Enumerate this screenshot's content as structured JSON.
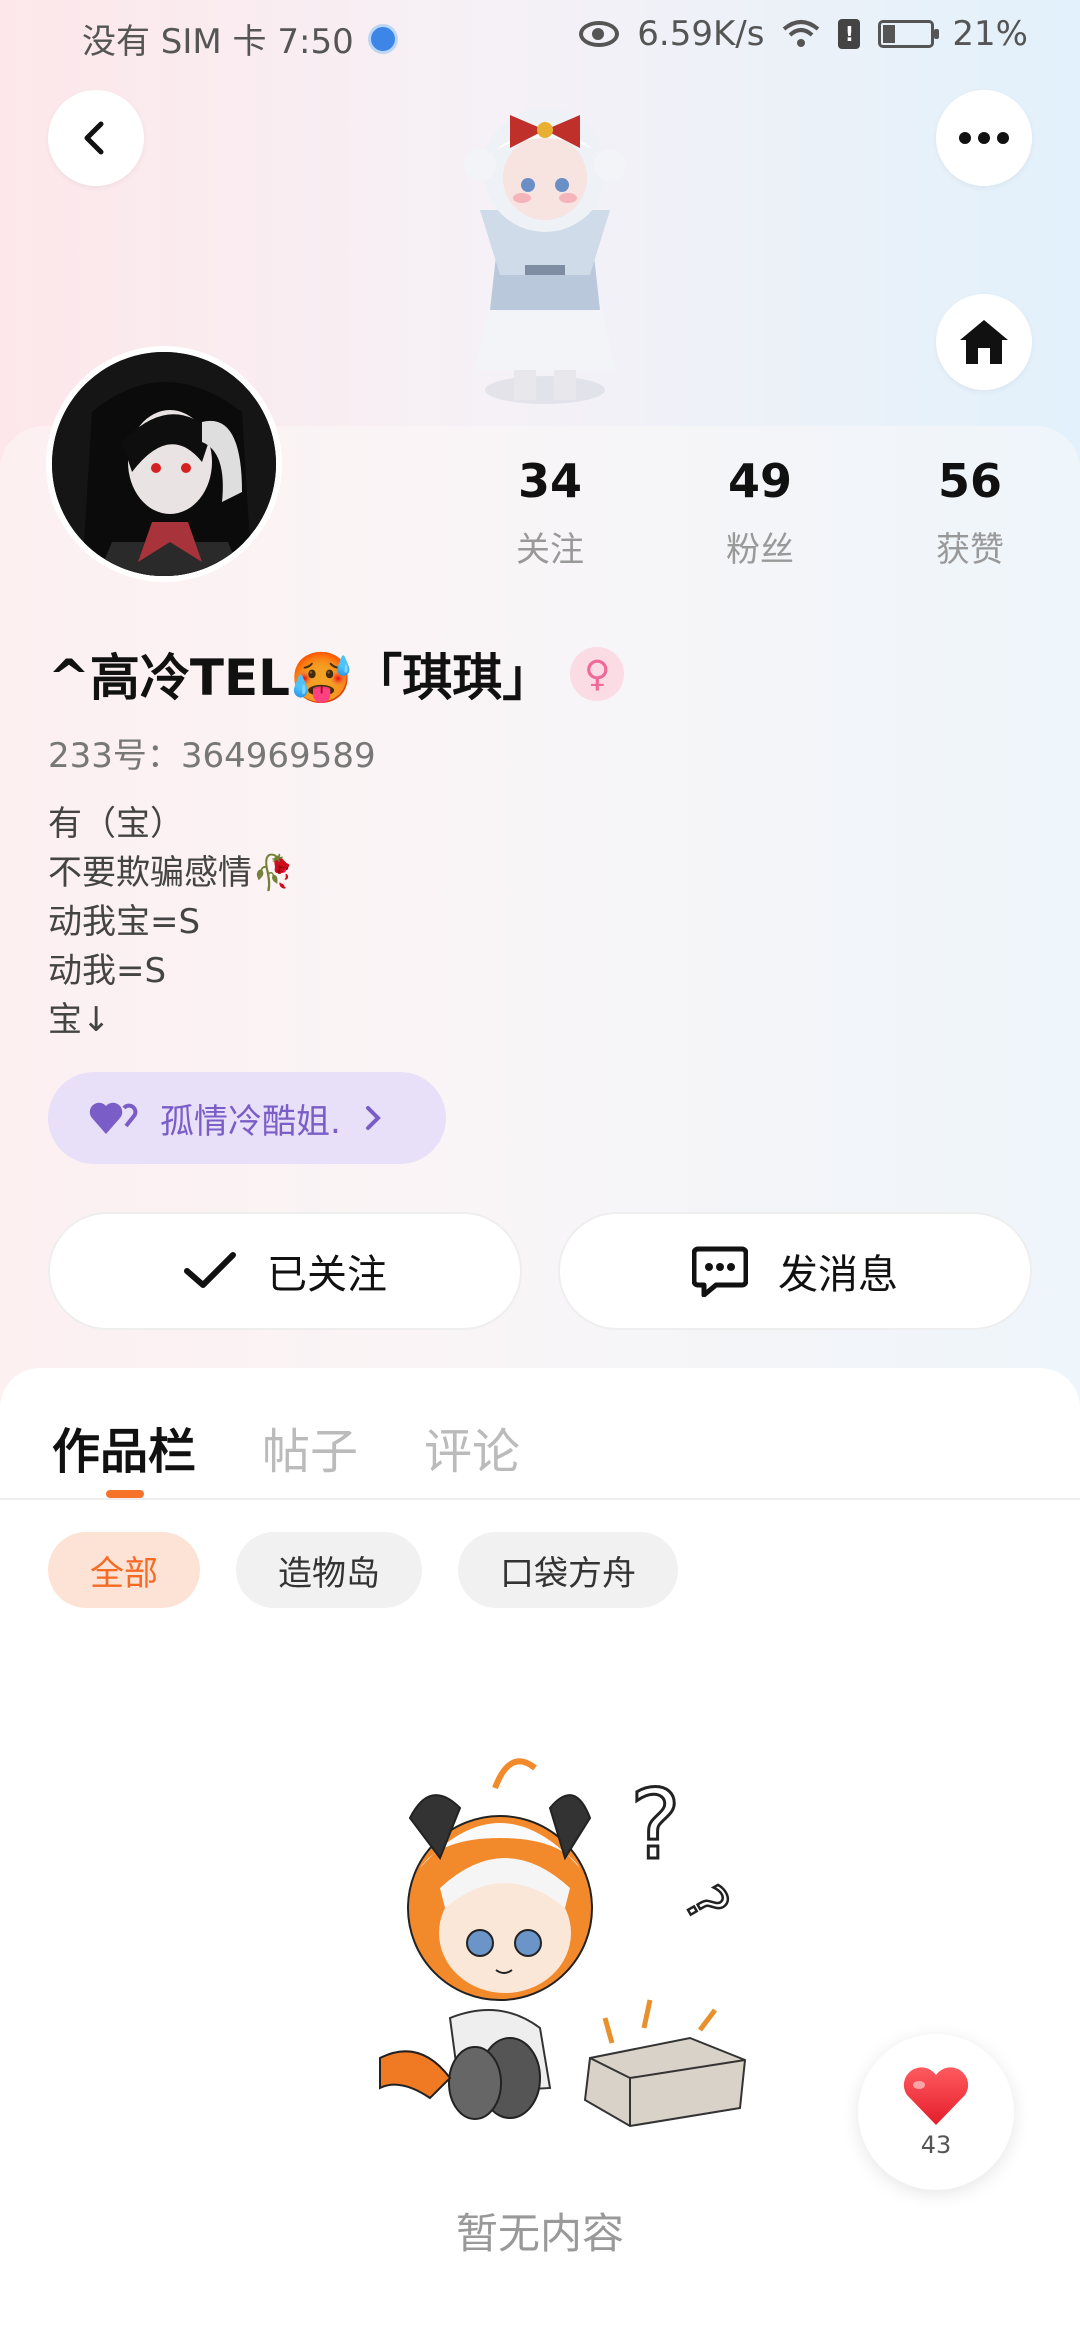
{
  "status_bar": {
    "left_text": "没有 SIM 卡 7:50",
    "speed": "6.59K/s",
    "battery": "21%"
  },
  "header": {
    "back_icon": "chevron-left-icon",
    "more_icon": "more-dots-icon",
    "home_icon": "home-icon"
  },
  "profile": {
    "stats": [
      {
        "value": "34",
        "label": "关注"
      },
      {
        "value": "49",
        "label": "粉丝"
      },
      {
        "value": "56",
        "label": "获赞"
      }
    ],
    "name": "^高冷TEL🥵「琪琪」",
    "gender_icon": "female-icon",
    "uid": "233号：364969589",
    "bio_lines": [
      "有（宝）",
      "不要欺骗感情🥀",
      "动我宝=S",
      "动我=S",
      "宝↓"
    ],
    "tag_label": "孤情冷酷姐.",
    "tag_icon": "purple-heart-icon",
    "follow_button": "已关注",
    "message_button": "发消息"
  },
  "content": {
    "tabs": [
      "作品栏",
      "帖子",
      "评论"
    ],
    "active_tab": "作品栏",
    "chips": [
      "全部",
      "造物岛",
      "口袋方舟"
    ],
    "active_chip": "全部",
    "empty_text": "暂无内容"
  },
  "like_fab": {
    "icon": "heart-icon",
    "count": "43"
  },
  "colors": {
    "accent_orange": "#f7732a",
    "tag_purple": "#7a5dc7",
    "heart_red": "#f2343f"
  }
}
